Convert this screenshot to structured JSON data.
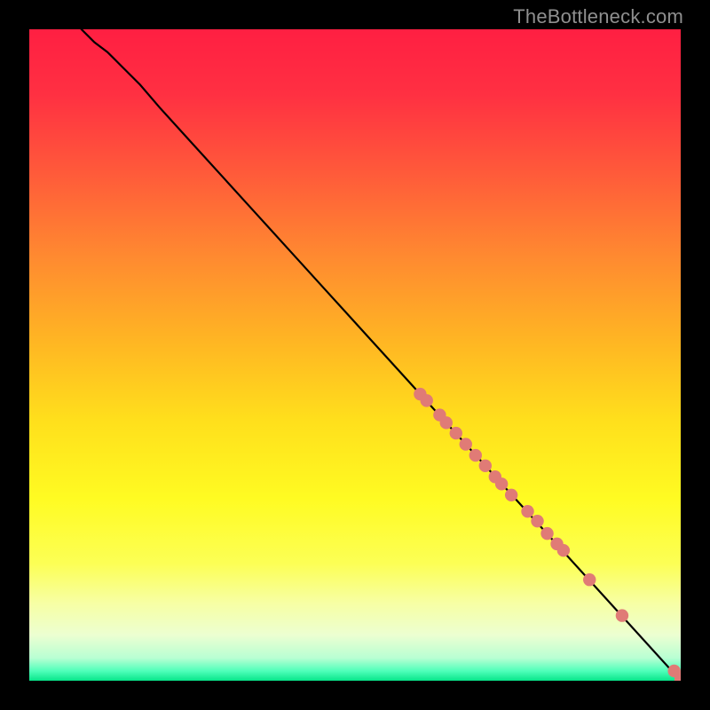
{
  "watermark": "TheBottleneck.com",
  "colors": {
    "curve": "#000000",
    "point_fill": "#e07b76",
    "point_stroke": "#e07b76",
    "gradient_stops": [
      {
        "offset": 0.0,
        "color": "#ff1f42"
      },
      {
        "offset": 0.1,
        "color": "#ff3042"
      },
      {
        "offset": 0.22,
        "color": "#ff5a3a"
      },
      {
        "offset": 0.35,
        "color": "#ff8a30"
      },
      {
        "offset": 0.48,
        "color": "#ffb623"
      },
      {
        "offset": 0.6,
        "color": "#ffdf1c"
      },
      {
        "offset": 0.72,
        "color": "#fffb22"
      },
      {
        "offset": 0.82,
        "color": "#fcff55"
      },
      {
        "offset": 0.88,
        "color": "#f7ffa3"
      },
      {
        "offset": 0.93,
        "color": "#ecffd1"
      },
      {
        "offset": 0.965,
        "color": "#b9ffd3"
      },
      {
        "offset": 0.985,
        "color": "#4fffba"
      },
      {
        "offset": 1.0,
        "color": "#07e58a"
      }
    ]
  },
  "chart_data": {
    "type": "line",
    "title": "",
    "xlabel": "",
    "ylabel": "",
    "xlim": [
      0,
      100
    ],
    "ylim": [
      0,
      100
    ],
    "grid": false,
    "legend": false,
    "series": [
      {
        "name": "curve",
        "x": [
          8,
          9,
          10,
          12,
          14,
          17,
          20,
          25,
          30,
          35,
          40,
          45,
          50,
          55,
          60,
          65,
          70,
          75,
          80,
          85,
          90,
          95,
          100
        ],
        "y": [
          100,
          99,
          98,
          96.5,
          94.5,
          91.5,
          88,
          82.5,
          77,
          71.5,
          66,
          60.5,
          55,
          49.5,
          44,
          38.5,
          33,
          27.5,
          22,
          16.5,
          11,
          5.5,
          0
        ]
      }
    ],
    "points": {
      "name": "highlighted-points",
      "x": [
        60,
        61,
        63,
        64,
        65.5,
        67,
        68.5,
        70,
        71.5,
        72.5,
        74,
        76.5,
        78,
        79.5,
        81,
        82,
        86,
        91,
        99,
        100,
        100
      ],
      "y": [
        44,
        43,
        40.8,
        39.6,
        38,
        36.3,
        34.6,
        33,
        31.3,
        30.2,
        28.5,
        26,
        24.5,
        22.6,
        21,
        20,
        15.5,
        10,
        1.5,
        0.6,
        0.0
      ]
    }
  }
}
